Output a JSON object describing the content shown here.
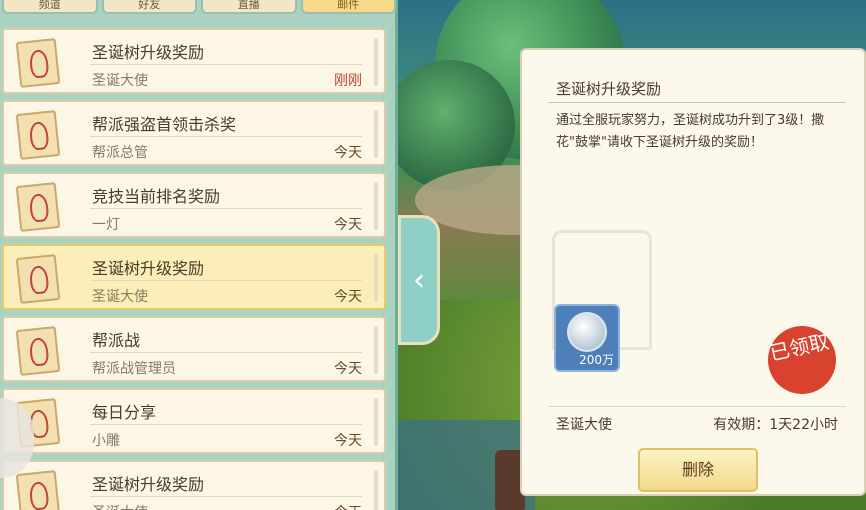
{
  "tabs": [
    {
      "label": "频道"
    },
    {
      "label": "好友"
    },
    {
      "label": "直播"
    },
    {
      "label": "邮件",
      "active": true
    }
  ],
  "mails": [
    {
      "title": "圣诞树升级奖励",
      "sender": "圣诞大使",
      "time": "刚刚",
      "new": true
    },
    {
      "title": "帮派强盗首领击杀奖",
      "sender": "帮派总管",
      "time": "今天"
    },
    {
      "title": "竞技当前排名奖励",
      "sender": "一灯",
      "time": "今天"
    },
    {
      "title": "圣诞树升级奖励",
      "sender": "圣诞大使",
      "time": "今天",
      "selected": true
    },
    {
      "title": "帮派战",
      "sender": "帮派战管理员",
      "time": "今天"
    },
    {
      "title": "每日分享",
      "sender": "小雕",
      "time": "今天"
    },
    {
      "title": "圣诞树升级奖励",
      "sender": "圣诞大使",
      "time": "今天"
    }
  ],
  "detail": {
    "title": "圣诞树升级奖励",
    "body": "通过全服玩家努力，圣诞树成功升到了3级！撒花\"鼓掌\"请收下圣诞树升级的奖励！",
    "reward_amount": "200万",
    "stamp_text": "已领取",
    "sender": "圣诞大使",
    "expiry": "有效期：1天22小时",
    "delete_label": "删除"
  },
  "colors": {
    "accent": "#f2d98a",
    "stamp": "#d9422e",
    "new_time": "#c0443a"
  },
  "icons": {
    "mail": "envelope-icon",
    "collapse": "chevron-left-icon",
    "reward": "silver-coin-icon"
  }
}
